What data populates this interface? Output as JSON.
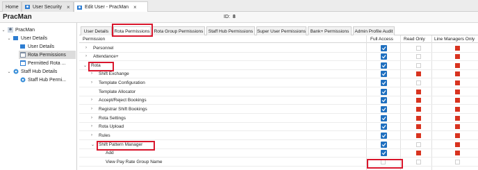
{
  "doc_tabs": [
    {
      "label": "Home"
    },
    {
      "label": "User Security"
    },
    {
      "label": "Edit User - PracMan"
    }
  ],
  "title": "PracMan",
  "id_label": "ID:",
  "id_value": "8",
  "tree": [
    {
      "label": "PracMan"
    },
    {
      "label": "User Details"
    },
    {
      "label": "User Details"
    },
    {
      "label": "Rota Permissions"
    },
    {
      "label": "Permitted Rota ..."
    },
    {
      "label": "Staff Hub Details"
    },
    {
      "label": "Staff Hub Permi..."
    }
  ],
  "inner_tabs": [
    {
      "label": "User Details"
    },
    {
      "label": "Rota Permissions"
    },
    {
      "label": "Rota Group Permissions"
    },
    {
      "label": "Staff Hub Permissions"
    },
    {
      "label": "Super User Permissions"
    },
    {
      "label": "Bank+ Permissions"
    },
    {
      "label": "Admin Profile Audit"
    }
  ],
  "grid": {
    "col_permission": "Permission",
    "col_full": "Full Access",
    "col_read": "Read Only",
    "col_line": "Line Managers Only",
    "rows": [
      {
        "label": "Personnel",
        "chevron": ">",
        "full": true,
        "read": false,
        "line": true
      },
      {
        "label": "Attendance+",
        "chevron": ">",
        "full": true,
        "read": false,
        "line": true
      },
      {
        "label": "Rota",
        "chevron": "v",
        "full": true,
        "read": false,
        "line": true
      },
      {
        "label": "Shift Exchange",
        "chevron": ">",
        "full": true,
        "read": true,
        "line": true
      },
      {
        "label": "Template Configuration",
        "chevron": ">",
        "full": true,
        "read": false,
        "line": true
      },
      {
        "label": "Template Allocator",
        "chevron": "",
        "full": true,
        "read": true,
        "line": true
      },
      {
        "label": "Accept/Reject Bookings",
        "chevron": ">",
        "full": true,
        "read": true,
        "line": true
      },
      {
        "label": "Registrar Shift Bookings",
        "chevron": ">",
        "full": true,
        "read": true,
        "line": true
      },
      {
        "label": "Rota Settings",
        "chevron": ">",
        "full": true,
        "read": true,
        "line": true
      },
      {
        "label": "Rota Upload",
        "chevron": ">",
        "full": true,
        "read": true,
        "line": true
      },
      {
        "label": "Rules",
        "chevron": ">",
        "full": true,
        "read": true,
        "line": true
      },
      {
        "label": "Shift Pattern Manager",
        "chevron": "v",
        "full": true,
        "read": false,
        "line": true
      },
      {
        "label": "Add",
        "chevron": "",
        "full": true,
        "read": true,
        "line": true
      },
      {
        "label": "View Pay Rate Group Name",
        "chevron": "",
        "full": false,
        "read": false,
        "line": false
      }
    ]
  },
  "colors": {
    "accent": "#1e6fbf",
    "red": "#d8331f",
    "highlight": "#d9152b"
  }
}
